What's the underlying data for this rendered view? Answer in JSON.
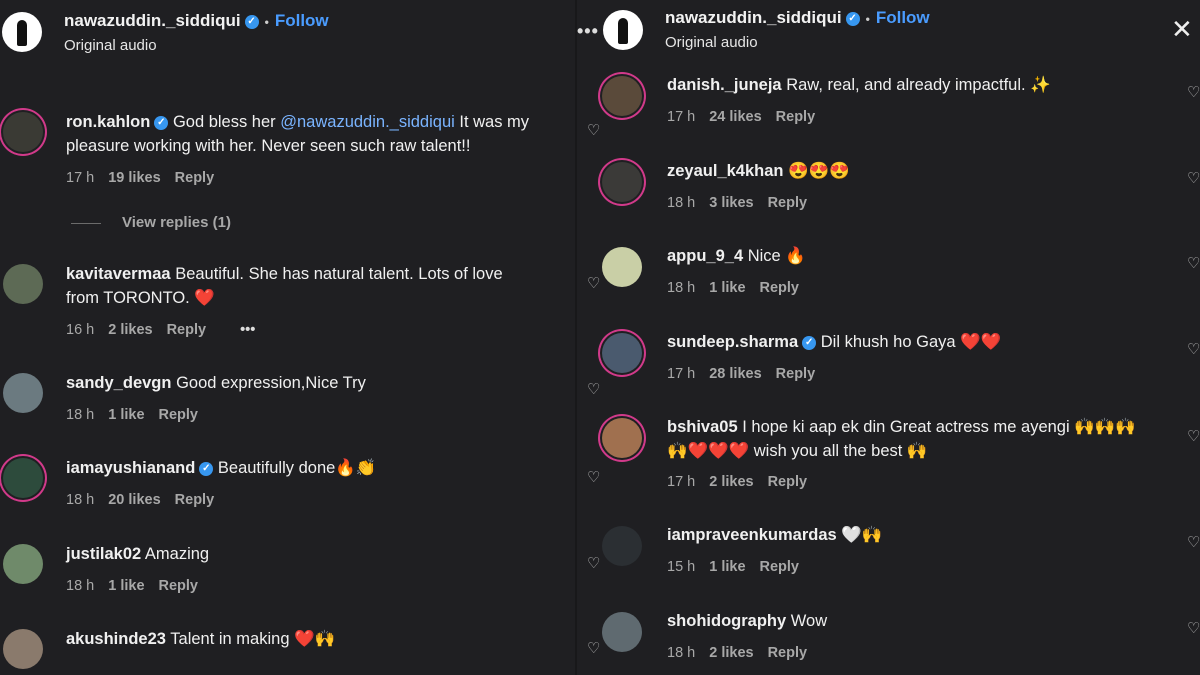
{
  "post": {
    "username": "nawazuddin._siddiqui",
    "subtitle": "Original audio",
    "follow_label": "Follow",
    "separator": "•",
    "more_label": "•••",
    "close_label": "✕"
  },
  "left_comments": [
    {
      "user": "ron.kahlon",
      "verified": true,
      "text_before": "God bless her ",
      "mention": "@nawazuddin._siddiqui",
      "text_line1_after": " It was my",
      "text_line2": "pleasure working with her. Never seen such raw talent!!",
      "time": "17 h",
      "likes": "19 likes",
      "reply": "Reply",
      "view_replies": "View replies (1)"
    },
    {
      "user": "kavitavermaa",
      "text": "Beautiful. She has natural talent. Lots of love",
      "text_line2": "from TORONTO. ❤️",
      "time": "16 h",
      "likes": "2 likes",
      "reply": "Reply",
      "more": "•••"
    },
    {
      "user": "sandy_devgn",
      "text": "Good expression,Nice Try",
      "time": "18 h",
      "likes": "1 like",
      "reply": "Reply"
    },
    {
      "user": "iamayushianand",
      "verified": true,
      "text": "Beautifully done🔥👏",
      "time": "18 h",
      "likes": "20 likes",
      "reply": "Reply"
    },
    {
      "user": "justilak02",
      "text": "Amazing",
      "time": "18 h",
      "likes": "1 like",
      "reply": "Reply"
    },
    {
      "user": "akushinde23",
      "text": "Talent in making ❤️🙌"
    }
  ],
  "right_comments": [
    {
      "user": "danish._juneja",
      "text": "Raw, real, and already impactful. ✨",
      "time": "17 h",
      "likes": "24 likes",
      "reply": "Reply"
    },
    {
      "user": "zeyaul_k4khan",
      "text": "😍😍😍",
      "time": "18 h",
      "likes": "3 likes",
      "reply": "Reply"
    },
    {
      "user": "appu_9_4",
      "text": "Nice 🔥",
      "time": "18 h",
      "likes": "1 like",
      "reply": "Reply"
    },
    {
      "user": "sundeep.sharma",
      "verified": true,
      "text": "Dil khush ho Gaya ❤️❤️",
      "time": "17 h",
      "likes": "28 likes",
      "reply": "Reply"
    },
    {
      "user": "bshiva05",
      "text": "I hope ki aap ek din Great actress me ayengi 🙌🙌🙌",
      "text_line2": "🙌❤️❤️❤️ wish you all the best 🙌",
      "time": "17 h",
      "likes": "2 likes",
      "reply": "Reply"
    },
    {
      "user": "iampraveenkumardas",
      "text": "🤍🙌",
      "time": "15 h",
      "likes": "1 like",
      "reply": "Reply"
    },
    {
      "user": "shohidography",
      "text": "Wow",
      "time": "18 h",
      "likes": "2 likes",
      "reply": "Reply"
    }
  ],
  "icons": {
    "heart": "heart-icon",
    "verified": "verified-badge-icon",
    "more": "more-options-icon",
    "close": "close-icon"
  },
  "colors": {
    "background": "#1f1f22",
    "link": "#4a9cff",
    "mention": "#7ab4ff",
    "verified": "#3797f0",
    "story_ring": "#d13a8a",
    "meta": "#a8a8a8"
  }
}
